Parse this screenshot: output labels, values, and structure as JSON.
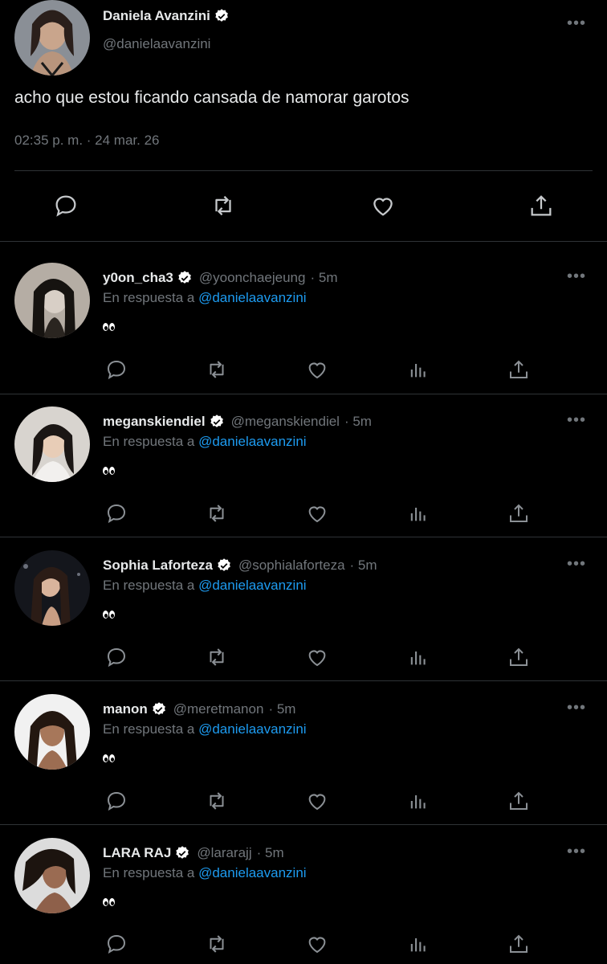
{
  "main_tweet": {
    "display_name": "Daniela Avanzini",
    "handle": "@danielaavanzini",
    "text": "acho que estou ficando cansada de namorar garotos",
    "timestamp": "02:35 p. m. · 24 mar. 26",
    "more": "•••"
  },
  "replies": [
    {
      "display_name": "y0on_cha3",
      "handle": "@yoonchaejeung",
      "time": "· 5m",
      "reply_label": "En respuesta a",
      "mention": "@danielaavanzini",
      "text": "👀"
    },
    {
      "display_name": "meganskiendiel",
      "handle": "@meganskiendiel",
      "time": "· 5m",
      "reply_label": "En respuesta a",
      "mention": "@danielaavanzini",
      "text": "👀"
    },
    {
      "display_name": "Sophia Laforteza",
      "handle": "@sophialaforteza",
      "time": "· 5m",
      "reply_label": "En respuesta a",
      "mention": "@danielaavanzini",
      "text": "👀"
    },
    {
      "display_name": "manon",
      "handle": "@meretmanon",
      "time": "· 5m",
      "reply_label": "En respuesta a",
      "mention": "@danielaavanzini",
      "text": "👀"
    },
    {
      "display_name": "LARA RAJ",
      "handle": "@lararajj",
      "time": "· 5m",
      "reply_label": "En respuesta a",
      "mention": "@danielaavanzini",
      "text": "👀"
    }
  ],
  "colors": {
    "background": "#000000",
    "text": "#e7e9ea",
    "muted": "#71767b",
    "link": "#1d9bf0",
    "divider": "#2f3336"
  },
  "icons": [
    "verified-badge-icon",
    "reply-icon",
    "retweet-icon",
    "like-icon",
    "views-icon",
    "share-icon",
    "more-icon"
  ]
}
